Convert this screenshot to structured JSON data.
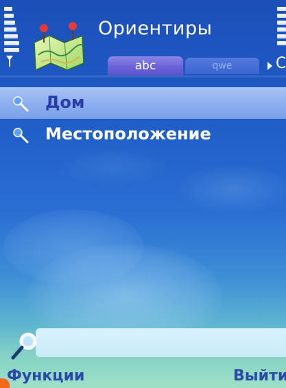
{
  "header": {
    "title": "Ориентиры",
    "app_icon": "map-pins-icon"
  },
  "tabs": [
    {
      "label": "abc",
      "active": true
    },
    {
      "label": "qwe",
      "active": false
    }
  ],
  "tab_more_glyph": "C",
  "landmarks": [
    {
      "label": "Дом",
      "icon": "pin-icon",
      "selected": true
    },
    {
      "label": "Местоположение",
      "icon": "pin-icon",
      "selected": false
    }
  ],
  "search": {
    "value": "",
    "icon": "search-icon"
  },
  "softkeys": {
    "left": "Функции",
    "right": "Выйти"
  },
  "colors": {
    "background": "#1f5cc6",
    "selected_row": "#8db0ef",
    "selected_text": "#2b3ea8",
    "softkey_text": "#2a4aa8",
    "search_field": "#d3eefb"
  }
}
